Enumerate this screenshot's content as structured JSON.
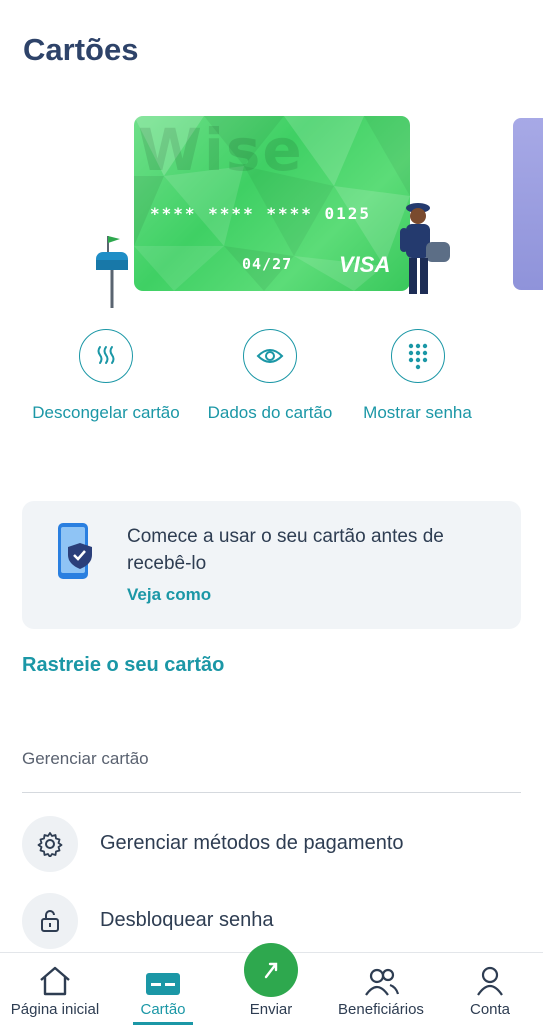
{
  "page": {
    "title": "Cartões"
  },
  "card": {
    "brand": "Wise",
    "number": "**** **** **** 0125",
    "expiry": "04/27",
    "network": "VISA",
    "color": "#3fd064"
  },
  "actions": [
    {
      "label": "Descongelar cartão",
      "icon": "thaw-icon"
    },
    {
      "label": "Dados do cartão",
      "icon": "eye-icon"
    },
    {
      "label": "Mostrar senha",
      "icon": "keypad-icon"
    }
  ],
  "banner": {
    "text": "Comece a usar o seu cartão antes de recebê-lo",
    "link": "Veja como"
  },
  "track_link": "Rastreie o seu cartão",
  "manage": {
    "section_title": "Gerenciar cartão",
    "items": [
      {
        "label": "Gerenciar métodos de pagamento",
        "icon": "gear-icon"
      },
      {
        "label": "Desbloquear senha",
        "icon": "unlock-icon"
      }
    ]
  },
  "nav": {
    "items": [
      {
        "label": "Página inicial",
        "icon": "home-icon"
      },
      {
        "label": "Cartão",
        "icon": "card-icon",
        "active": true
      },
      {
        "label": "Enviar",
        "icon": "send-icon"
      },
      {
        "label": "Beneficiários",
        "icon": "recipients-icon"
      },
      {
        "label": "Conta",
        "icon": "account-icon"
      }
    ]
  },
  "colors": {
    "accent": "#1b97a6",
    "title": "#2e4369",
    "send": "#2ea84e"
  }
}
